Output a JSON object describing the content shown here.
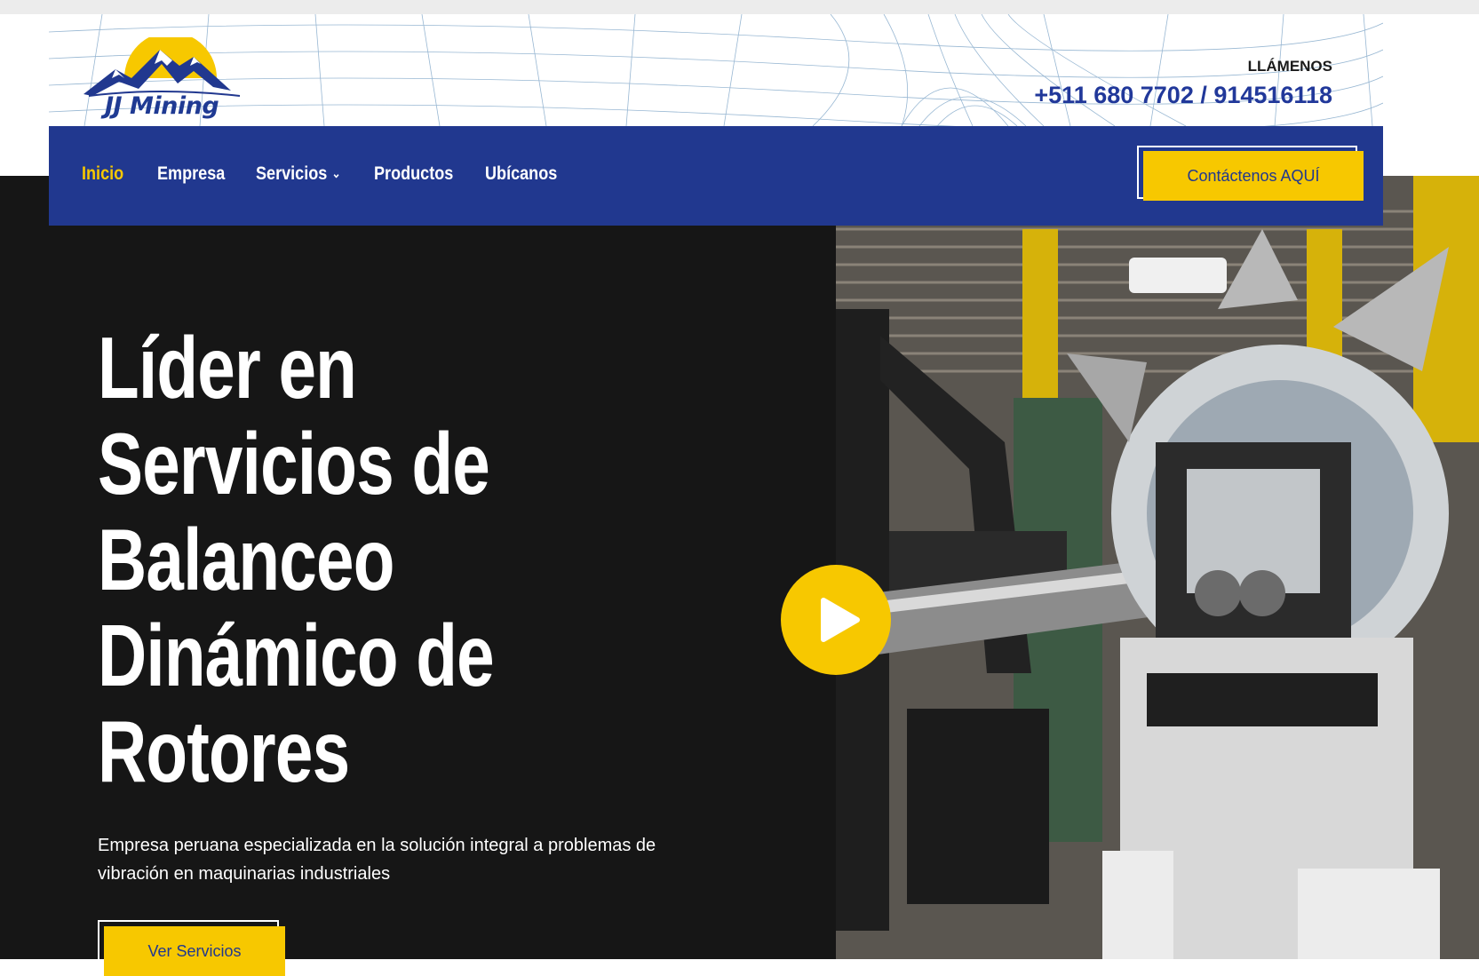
{
  "brand": {
    "name": "JJ Mining"
  },
  "header": {
    "call_label": "LLÁMENOS",
    "phone": "+511 680 7702 / 914516118"
  },
  "nav": {
    "items": [
      {
        "label": "Inicio",
        "active": true
      },
      {
        "label": "Empresa",
        "active": false
      },
      {
        "label": "Servicios",
        "active": false,
        "dropdown": true
      },
      {
        "label": "Productos",
        "active": false
      },
      {
        "label": "Ubícanos",
        "active": false
      }
    ],
    "cta_label": "Contáctenos AQUÍ"
  },
  "hero": {
    "headline_lines": [
      "Líder en",
      "Servicios de",
      "Balanceo",
      "Dinámico de",
      "Rotores"
    ],
    "subtext": "Empresa peruana especializada en la solución integral a problemas de vibración en maquinarias industriales",
    "button_label": "Ver Servicios",
    "play_icon": "play-icon"
  },
  "colors": {
    "brand_blue": "#21388f",
    "accent_yellow": "#f7c800",
    "hero_bg": "#161616"
  }
}
